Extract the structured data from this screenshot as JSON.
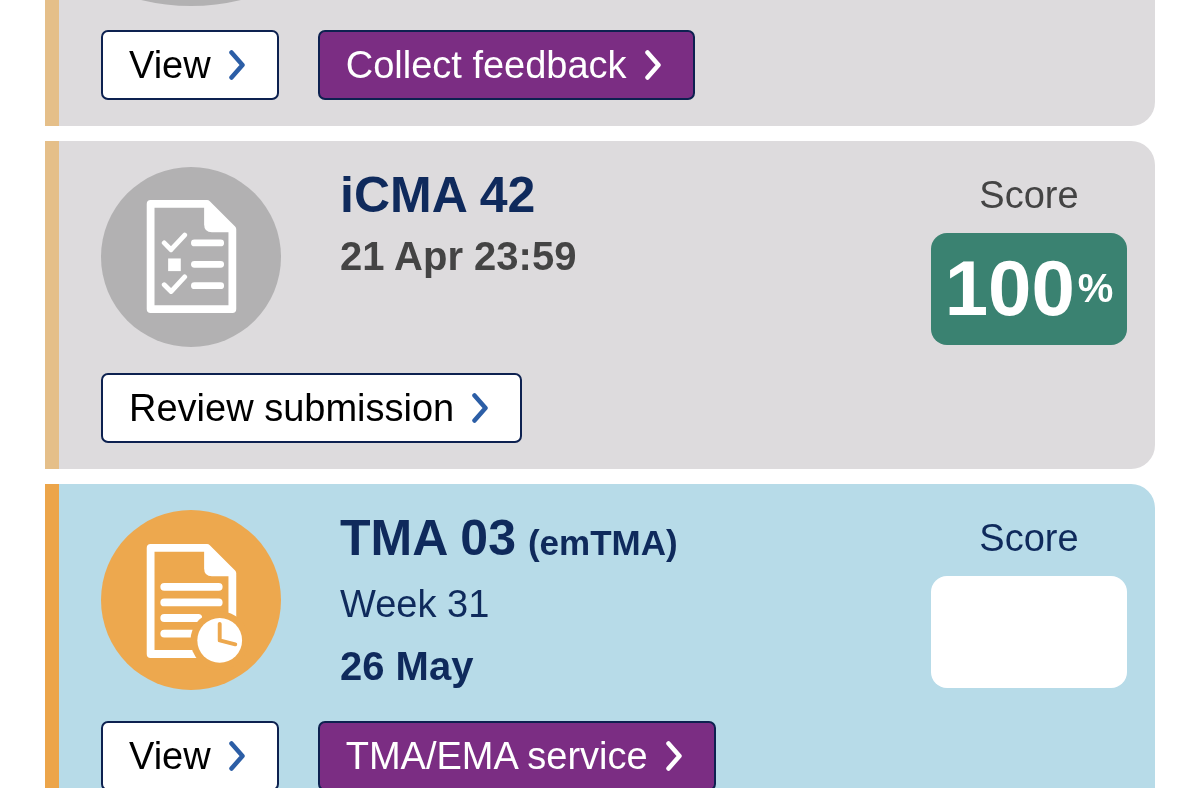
{
  "cards": [
    {
      "current": false,
      "buttons": [
        {
          "label": "View",
          "kind": "outline"
        },
        {
          "label": "Collect feedback",
          "kind": "filled"
        }
      ]
    },
    {
      "current": false,
      "kind": "quiz",
      "title": "iCMA 42",
      "due": "21 Apr 23:59",
      "score_label": "Score",
      "score": "100$^{%}$",
      "buttons": [
        {
          "label": "Review submission",
          "kind": "outline"
        }
      ]
    },
    {
      "current": true,
      "kind": "assignment",
      "title": "TMA 03",
      "title_note": "(emTMA)",
      "week": "Week 31",
      "due": "26 May",
      "score_label": "Score",
      "buttons": [
        {
          "label": "View",
          "kind": "outline"
        },
        {
          "label": "TMA/EMA service",
          "kind": "filled"
        }
      ]
    }
  ]
}
